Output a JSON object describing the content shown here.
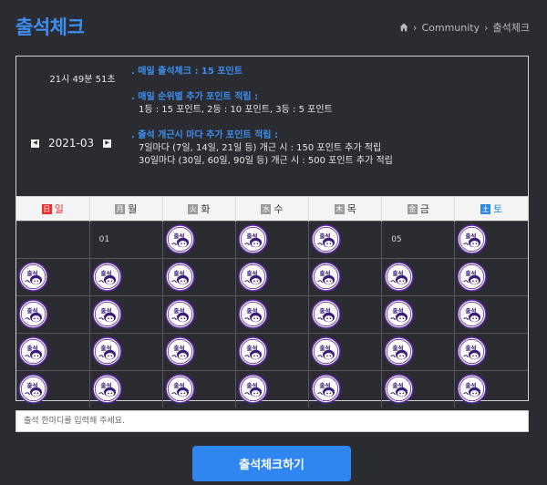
{
  "header": {
    "title": "출석체크",
    "breadcrumb": [
      "Community",
      "출석체크"
    ]
  },
  "clock": "21시 49분 51초",
  "calendar_nav": {
    "month": "2021-03",
    "prev_icon": "chevron-left-icon",
    "next_icon": "chevron-right-icon"
  },
  "info": {
    "daily_heading": ". 매일 출석체크 : 15 포인트",
    "rank_heading": ". 매일 순위별 추가 포인트 적립 :",
    "rank_line": "1등 : 15 포인트,  2등 : 10 포인트,  3등 : 5 포인트",
    "streak_heading": ". 출석 개근시 마다 추가 포인트 적립 :",
    "streak_line1": "7일마다 (7일, 14일, 21일 등) 개근 시 : 150 포인트 추가 적립",
    "streak_line2": "30일마다 (30일, 60일, 90일 등) 개근 시 : 500 포인트 추가 적립"
  },
  "weekdays": [
    {
      "badge": "日",
      "name": "일"
    },
    {
      "badge": "月",
      "name": "월"
    },
    {
      "badge": "火",
      "name": "화"
    },
    {
      "badge": "水",
      "name": "수"
    },
    {
      "badge": "木",
      "name": "목"
    },
    {
      "badge": "金",
      "name": "금"
    },
    {
      "badge": "土",
      "name": "토"
    }
  ],
  "weeks": [
    [
      null,
      "01",
      "stamp",
      "stamp",
      "stamp",
      "05",
      "stamp"
    ],
    [
      "stamp",
      "stamp",
      "stamp",
      "stamp",
      "stamp",
      "stamp",
      "stamp"
    ],
    [
      "stamp",
      "stamp",
      "stamp",
      "stamp",
      "stamp",
      "stamp",
      "stamp"
    ],
    [
      "stamp",
      "stamp",
      "stamp",
      "stamp",
      "stamp",
      "stamp",
      "stamp"
    ],
    [
      "stamp",
      "stamp",
      "stamp",
      "stamp",
      "stamp",
      "stamp",
      "stamp"
    ]
  ],
  "stamp_text": "출석",
  "comment": {
    "placeholder": "출석 한마디를 입력해 주세요.",
    "value": ""
  },
  "submit_label": "출석체크하기",
  "colors": {
    "accent": "#2f86f0",
    "sunday": "#e83030",
    "saturday": "#2d86e0",
    "stamp_ring": "#5a2aa0"
  }
}
